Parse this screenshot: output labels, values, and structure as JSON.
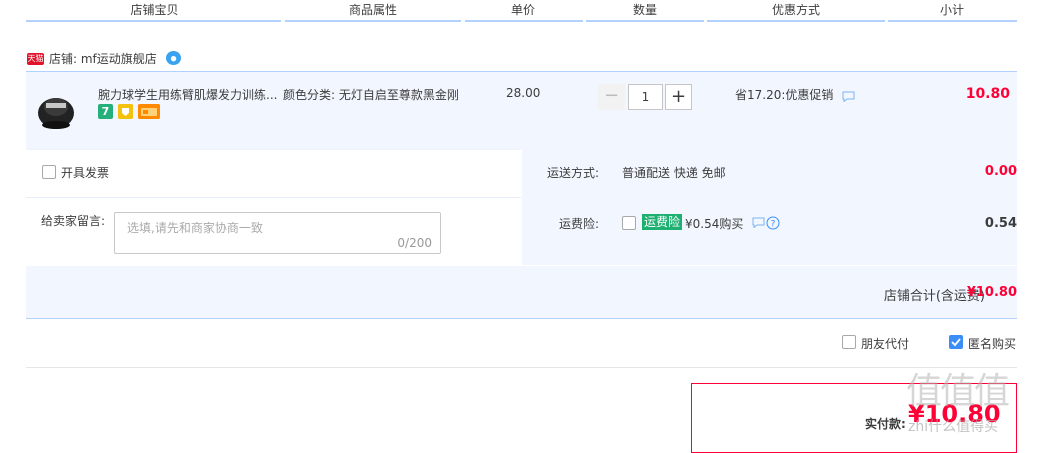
{
  "header": {
    "columns": [
      "店铺宝贝",
      "商品属性",
      "单价",
      "数量",
      "优惠方式",
      "小计"
    ]
  },
  "shop": {
    "badge": "天猫",
    "label": "店铺: mf运动旗舰店"
  },
  "item": {
    "title": "腕力球学生用练臂肌爆发力训练...",
    "sku": "颜色分类: 无灯自启至尊款黑金刚",
    "price": "28.00",
    "quantity": "1",
    "promo": "省17.20:优惠促销",
    "subtotal": "10.80",
    "badge_seven": "7"
  },
  "invoice": {
    "label": "开具发票"
  },
  "shipping": {
    "label": "运送方式:",
    "value": "普通配送 快递 免邮",
    "fee": "0.00"
  },
  "message": {
    "label": "给卖家留言:",
    "placeholder": "选填,请先和商家协商一致",
    "count": "0/200"
  },
  "insurance": {
    "label": "运费险:",
    "tag": "运费险",
    "price": "¥0.54购买",
    "fee": "0.54"
  },
  "total": {
    "label": "店铺合计(含运费)",
    "value": "¥10.80"
  },
  "options": {
    "friend_pay": "朋友代付",
    "anonymous": "匿名购买"
  },
  "pay": {
    "label": "实付款:",
    "value": "¥10.80"
  },
  "watermark": {
    "text": "值值值",
    "sub": "zhi什么值得买"
  },
  "colors": {
    "accent_red": "#ff0036",
    "line_blue": "#b2d1ff",
    "row_bg": "#f2f7ff",
    "ins_green": "#1db070",
    "check_blue": "#3a8ef6"
  }
}
